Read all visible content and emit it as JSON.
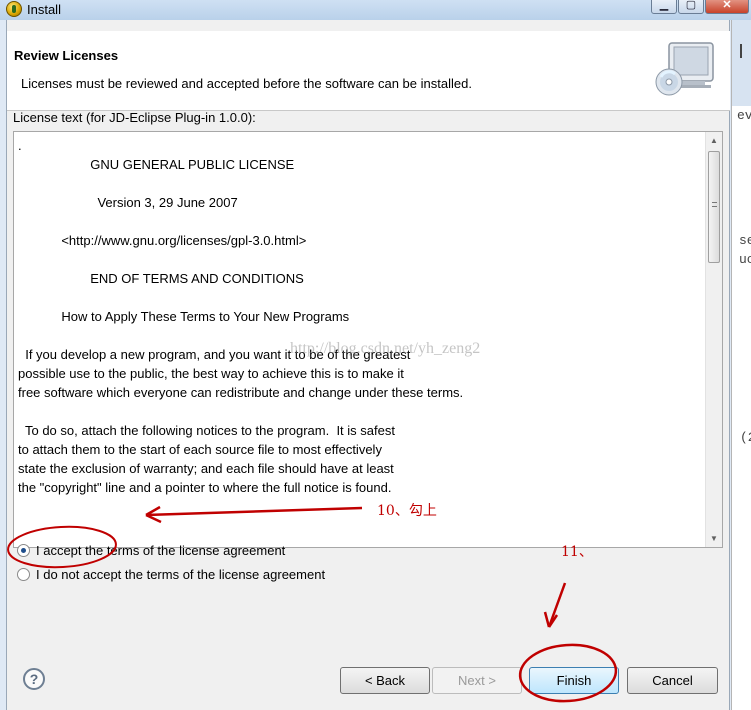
{
  "window": {
    "title": "Install",
    "controls": {
      "minimize": "▁",
      "maximize": "▢",
      "close": "✕"
    }
  },
  "banner": {
    "title": "Review Licenses",
    "description": "Licenses must be reviewed and accepted before the software can be installed.",
    "graphic_icon": "computer-cd-icon"
  },
  "license": {
    "label": "License text (for JD-Eclipse Plug-in 1.0.0):",
    "text": ".\n                    GNU GENERAL PUBLIC LICENSE\n\n                      Version 3, 29 June 2007\n\n            <http://www.gnu.org/licenses/gpl-3.0.html>\n\n                    END OF TERMS AND CONDITIONS\n\n            How to Apply These Terms to Your New Programs\n\n  If you develop a new program, and you want it to be of the greatest\npossible use to the public, the best way to achieve this is to make it\nfree software which everyone can redistribute and change under these terms.\n\n  To do so, attach the following notices to the program.  It is safest\nto attach them to the start of each source file to most effectively\nstate the exclusion of warranty; and each file should have at least\nthe \"copyright\" line and a pointer to where the full notice is found.",
    "watermark": "http://blog.csdn.net/yh_zeng2"
  },
  "options": {
    "accept": {
      "label": "I accept the terms of the license agreement",
      "selected": true
    },
    "decline": {
      "label": "I do not accept the terms of the license agreement",
      "selected": false
    }
  },
  "buttons": {
    "help": "?",
    "back": "< Back",
    "next": "Next >",
    "finish": "Finish",
    "cancel": "Cancel"
  },
  "background_window": {
    "fragments": [
      "ev",
      "se",
      "uc",
      "(2"
    ]
  },
  "annotations": {
    "step10": "10、勾上",
    "step11": "11、",
    "color": "#c00000"
  },
  "colors": {
    "titlebar": "#c4d9ef",
    "dialog": "#f0f0f0",
    "default_button": "#bee6fd"
  }
}
